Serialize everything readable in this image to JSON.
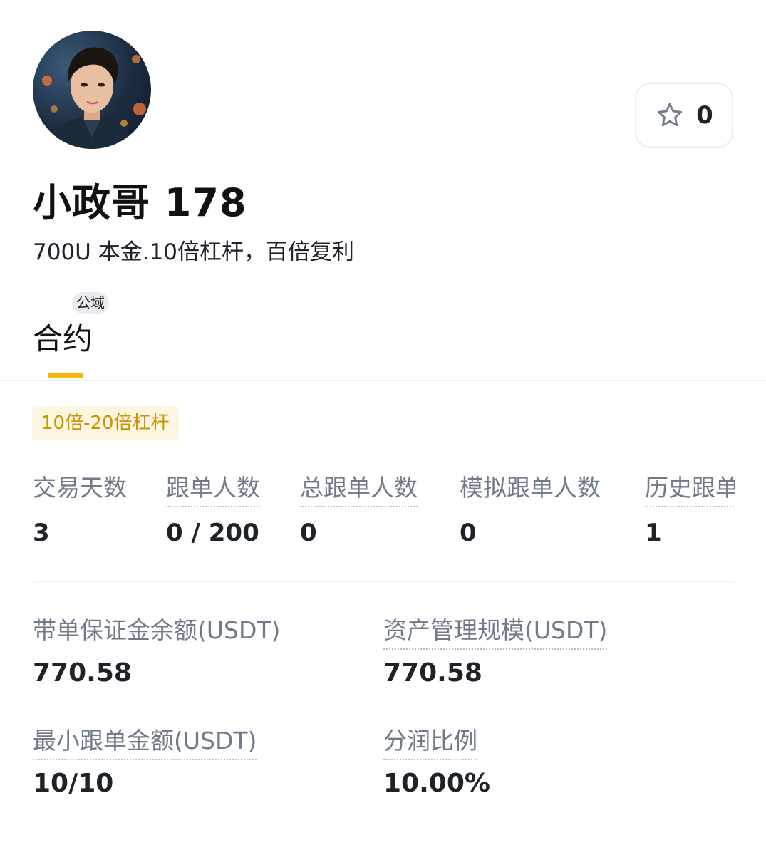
{
  "profile": {
    "name": "小政哥 178",
    "bio": "700U 本金.10倍杠杆，百倍复利",
    "avatar_icon": "user-avatar-portrait"
  },
  "favorite": {
    "icon": "star-icon",
    "count": "0"
  },
  "tabs": [
    {
      "label": "合约",
      "badge": "公域",
      "active": true
    }
  ],
  "leverage_tag": "10倍-20倍杠杆",
  "stats": [
    {
      "label": "交易天数",
      "value": "3"
    },
    {
      "label": "跟单人数",
      "value": "0 / 200"
    },
    {
      "label": "总跟单人数",
      "value": "0"
    },
    {
      "label": "模拟跟单人数",
      "value": "0"
    },
    {
      "label": "历史跟单",
      "value": "1"
    }
  ],
  "metrics": {
    "margin_balance": {
      "label": "带单保证金余额(USDT)",
      "value": "770.58"
    },
    "aum": {
      "label": "资产管理规模(USDT)",
      "value": "770.58"
    },
    "min_copy": {
      "label": "最小跟单金额(USDT)",
      "value": "10/10"
    },
    "profit_share": {
      "label": "分润比例",
      "value": "10.00%"
    }
  },
  "colors": {
    "accent": "#f0b90b",
    "tag_text": "#c99400",
    "tag_bg": "#fdf6e1",
    "label_gray": "#707a8a",
    "text_dark": "#1e2329"
  }
}
